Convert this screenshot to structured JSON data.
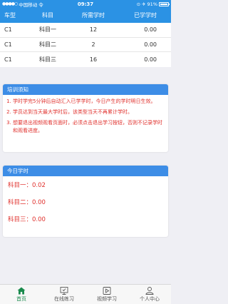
{
  "status": {
    "carrier": "中国移动",
    "network": "令",
    "time": "09:37",
    "battery": "91%"
  },
  "table": {
    "headers": [
      "车型",
      "科目",
      "所需学时",
      "已学学时"
    ],
    "rows": [
      {
        "type": "C1",
        "subject": "科目一",
        "required": "12",
        "done": "0.00"
      },
      {
        "type": "C1",
        "subject": "科目二",
        "required": "2",
        "done": "0.00"
      },
      {
        "type": "C1",
        "subject": "科目三",
        "required": "16",
        "done": "0.00"
      }
    ]
  },
  "notice": {
    "title": "培训须知",
    "items": [
      "学时学完5分钟后自动汇入已学学时，今日产生的学时明日生效。",
      "学员达到当天最大学时后，该类型当天不再累计学时。",
      "想要退出视频观看页面时，必须点击退出学习按钮，否则不记录学时和观看进度。"
    ]
  },
  "today": {
    "title": "今日学时",
    "entries": [
      "科目一：0.02",
      "科目二：0.00",
      "科目三：0.00"
    ]
  },
  "tabs": [
    {
      "label": "首页",
      "icon": "home-icon",
      "active": true
    },
    {
      "label": "在线练习",
      "icon": "practice-icon",
      "active": false
    },
    {
      "label": "视频学习",
      "icon": "video-icon",
      "active": false
    },
    {
      "label": "个人中心",
      "icon": "user-icon",
      "active": false
    }
  ],
  "colors": {
    "primary": "#2b92e4",
    "card_header": "#3d8de6",
    "red_text": "#e0312d",
    "active_tab": "#1a8a4d"
  }
}
